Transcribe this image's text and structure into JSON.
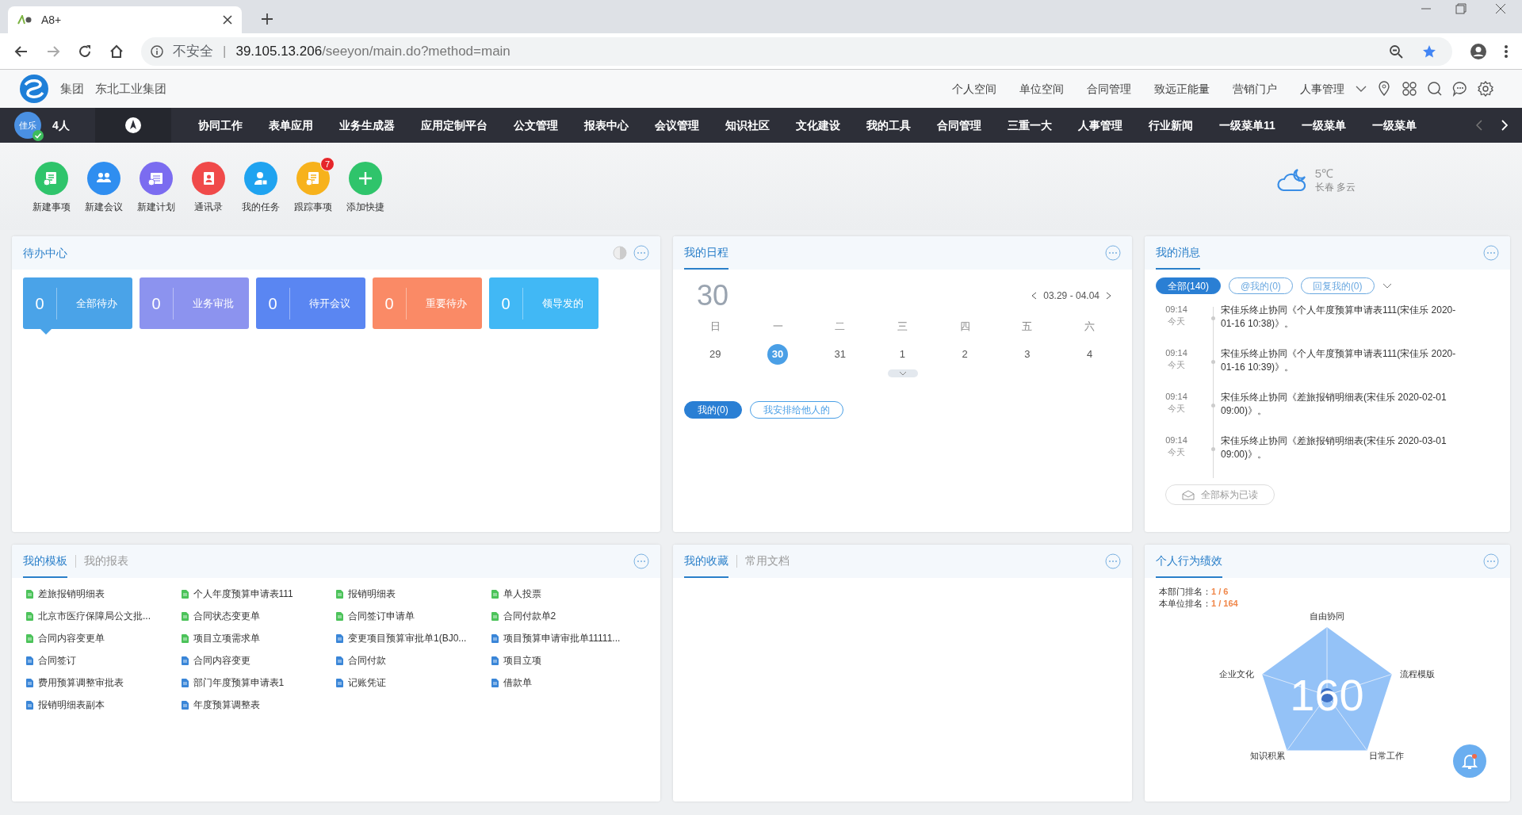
{
  "browser": {
    "tab_title": "A8+",
    "security": "不安全",
    "separator": "|",
    "url_host": "39.105.13.206",
    "url_path": "/seeyon/main.do?method=main"
  },
  "header": {
    "org_type": "集团",
    "org_name": "东北工业集团",
    "links": [
      "个人空间",
      "单位空间",
      "合同管理",
      "致远正能量",
      "营销门户",
      "人事管理"
    ]
  },
  "nav": {
    "avatar": "佳乐",
    "online": "4人",
    "items": [
      "协同工作",
      "表单应用",
      "业务生成器",
      "应用定制平台",
      "公文管理",
      "报表中心",
      "会议管理",
      "知识社区",
      "文化建设",
      "我的工具",
      "合同管理",
      "三重一大",
      "人事管理",
      "行业新闻",
      "一级菜单11",
      "一级菜单",
      "一级菜单"
    ]
  },
  "shortcuts": [
    {
      "label": "新建事项",
      "color": "#2fc46b"
    },
    {
      "label": "新建会议",
      "color": "#2f8ef0"
    },
    {
      "label": "新建计划",
      "color": "#7b6cf0"
    },
    {
      "label": "通讯录",
      "color": "#f04a4a"
    },
    {
      "label": "我的任务",
      "color": "#1fa3f0"
    },
    {
      "label": "跟踪事项",
      "color": "#f7b21c",
      "badge": "7"
    },
    {
      "label": "添加快捷",
      "color": "#2fc46b"
    }
  ],
  "weather": {
    "temp": "5℃",
    "desc": "长春 多云"
  },
  "todo": {
    "title": "待办中心",
    "cards": [
      {
        "count": "0",
        "label": "全部待办",
        "color": "#4aa3e8",
        "selected": true
      },
      {
        "count": "0",
        "label": "业务审批",
        "color": "#8c93ef",
        "selected": false
      },
      {
        "count": "0",
        "label": "待开会议",
        "color": "#5a86f2",
        "selected": false
      },
      {
        "count": "0",
        "label": "重要待办",
        "color": "#fa8a66",
        "selected": false
      },
      {
        "count": "0",
        "label": "领导发的",
        "color": "#41b8f5",
        "selected": false
      }
    ]
  },
  "schedule": {
    "title": "我的日程",
    "big_day": "30",
    "range": "03.29 - 04.04",
    "weekdays": [
      "日",
      "一",
      "二",
      "三",
      "四",
      "五",
      "六"
    ],
    "days": [
      {
        "label": "29",
        "selected": false
      },
      {
        "label": "30",
        "selected": true
      },
      {
        "label": "31",
        "selected": false
      },
      {
        "label": "1",
        "selected": false
      },
      {
        "label": "2",
        "selected": false
      },
      {
        "label": "3",
        "selected": false
      },
      {
        "label": "4",
        "selected": false
      }
    ],
    "filters": [
      {
        "label": "我的(0)",
        "selected": true
      },
      {
        "label": "我安排给他人的",
        "selected": false
      }
    ]
  },
  "messages": {
    "title": "我的消息",
    "filters": [
      {
        "label": "全部(140)",
        "selected": true
      },
      {
        "label": "@我的(0)",
        "selected": false
      },
      {
        "label": "回复我的(0)",
        "selected": false
      }
    ],
    "items": [
      {
        "time": "09:14",
        "day": "今天",
        "text": "宋佳乐终止协同《个人年度预算申请表111(宋佳乐 2020-01-16 10:38)》。"
      },
      {
        "time": "09:14",
        "day": "今天",
        "text": "宋佳乐终止协同《个人年度预算申请表111(宋佳乐 2020-01-16 10:39)》。"
      },
      {
        "time": "09:14",
        "day": "今天",
        "text": "宋佳乐终止协同《差旅报销明细表(宋佳乐 2020-02-01 09:00)》。"
      },
      {
        "time": "09:14",
        "day": "今天",
        "text": "宋佳乐终止协同《差旅报销明细表(宋佳乐 2020-03-01 09:00)》。"
      }
    ],
    "mark_all": "全部标为已读"
  },
  "templates": {
    "tabs": [
      {
        "label": "我的模板",
        "selected": true
      },
      {
        "label": "我的报表",
        "selected": false
      }
    ],
    "items": [
      {
        "label": "差旅报销明细表",
        "color": "#4cc35a"
      },
      {
        "label": "个人年度预算申请表111",
        "color": "#4cc35a"
      },
      {
        "label": "报销明细表",
        "color": "#4cc35a"
      },
      {
        "label": "单人投票",
        "color": "#4cc35a"
      },
      {
        "label": "北京市医疗保障局公文批...",
        "color": "#4cc35a"
      },
      {
        "label": "合同状态变更单",
        "color": "#4cc35a"
      },
      {
        "label": "合同签订申请单",
        "color": "#4cc35a"
      },
      {
        "label": "合同付款单2",
        "color": "#4cc35a"
      },
      {
        "label": "合同内容变更单",
        "color": "#4cc35a"
      },
      {
        "label": "项目立项需求单",
        "color": "#4cc35a"
      },
      {
        "label": "变更项目预算审批单1(BJ0...",
        "color": "#3a86d8"
      },
      {
        "label": "项目预算申请审批单11111...",
        "color": "#3a86d8"
      },
      {
        "label": "合同签订",
        "color": "#3a86d8"
      },
      {
        "label": "合同内容变更",
        "color": "#3a86d8"
      },
      {
        "label": "合同付款",
        "color": "#3a86d8"
      },
      {
        "label": "项目立项",
        "color": "#3a86d8"
      },
      {
        "label": "费用预算调整审批表",
        "color": "#3a86d8"
      },
      {
        "label": "部门年度预算申请表1",
        "color": "#3a86d8"
      },
      {
        "label": "记账凭证",
        "color": "#3a86d8"
      },
      {
        "label": "借款单",
        "color": "#3a86d8"
      },
      {
        "label": "报销明细表副本",
        "color": "#3a86d8"
      },
      {
        "label": "年度预算调整表",
        "color": "#3a86d8"
      }
    ]
  },
  "favorites": {
    "tabs": [
      {
        "label": "我的收藏",
        "selected": true
      },
      {
        "label": "常用文档",
        "selected": false
      }
    ]
  },
  "performance": {
    "title": "个人行为绩效",
    "dept_label": "本部门排名：",
    "dept_rank": "1 / 6",
    "unit_label": "本单位排名：",
    "unit_rank": "1 / 164",
    "score": "160",
    "axes": [
      "自由协同",
      "流程模版",
      "日常工作",
      "知识积累",
      "企业文化"
    ]
  }
}
